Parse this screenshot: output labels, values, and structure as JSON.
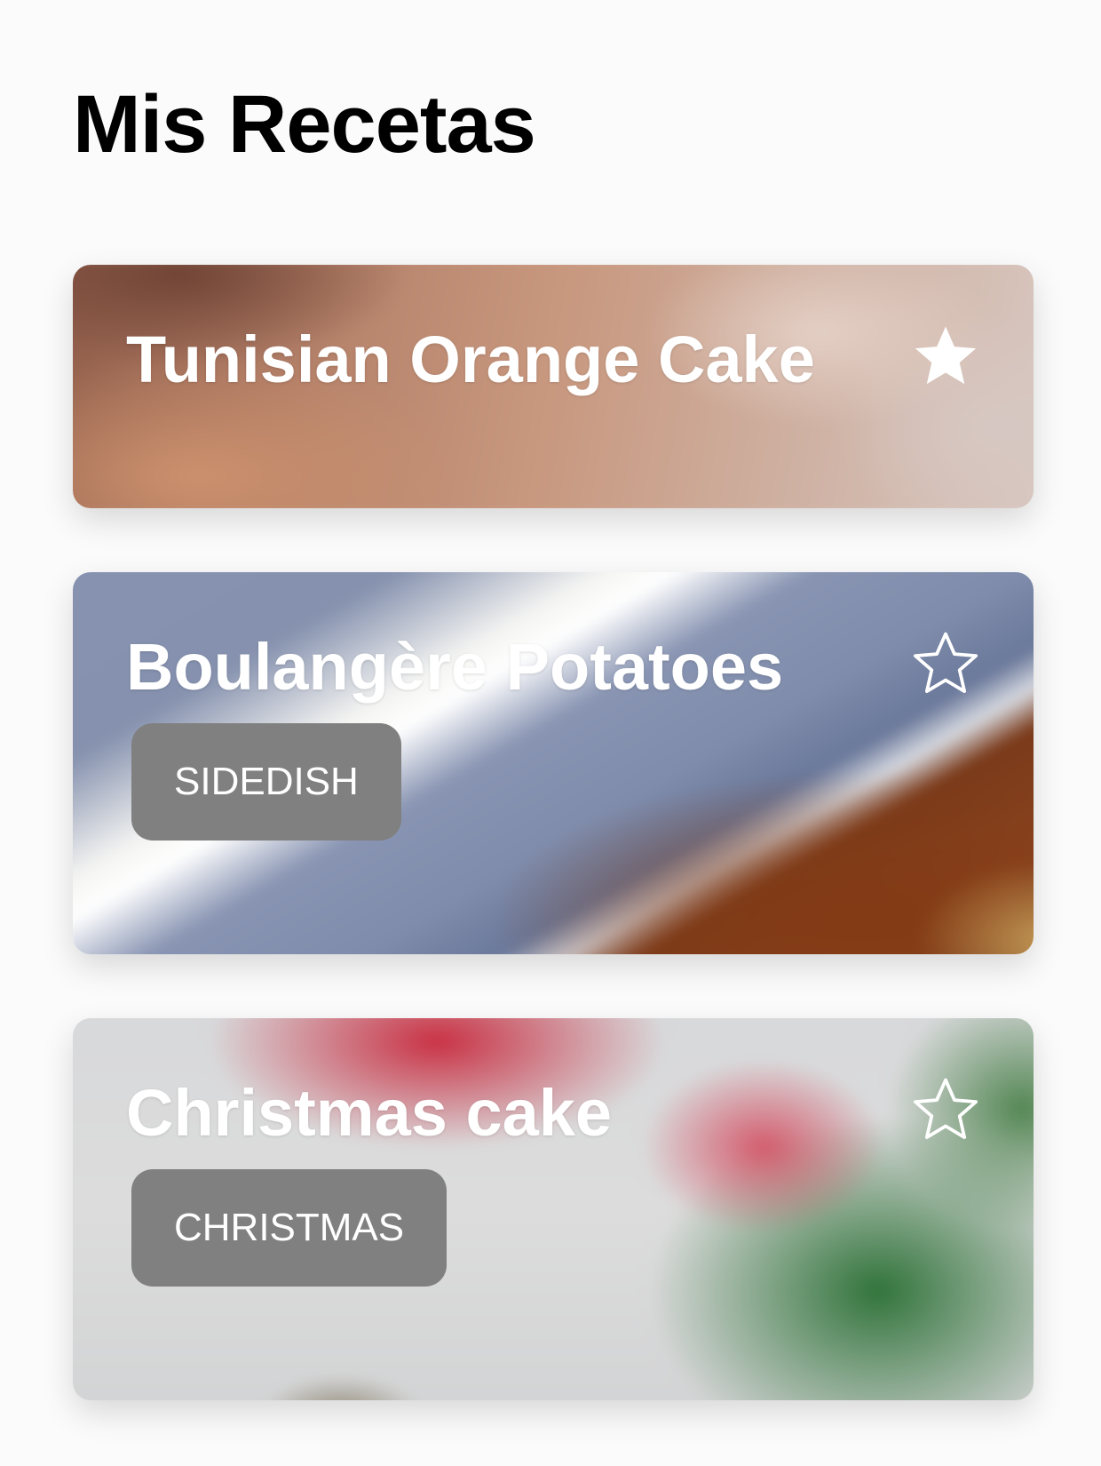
{
  "page": {
    "title": "Mis Recetas"
  },
  "recipes": [
    {
      "title": "Tunisian Orange Cake",
      "favorite": true,
      "favorite_icon": "star-filled-icon",
      "tag": ""
    },
    {
      "title": "Boulangère Potatoes",
      "favorite": false,
      "favorite_icon": "star-outline-icon",
      "tag": "SIDEDISH"
    },
    {
      "title": "Christmas cake",
      "favorite": false,
      "favorite_icon": "star-outline-icon",
      "tag": "CHRISTMAS"
    }
  ],
  "colors": {
    "title_text": "#000000",
    "card_text": "#ffffff",
    "tag_background": "#808080",
    "tag_text": "#ffffff"
  }
}
